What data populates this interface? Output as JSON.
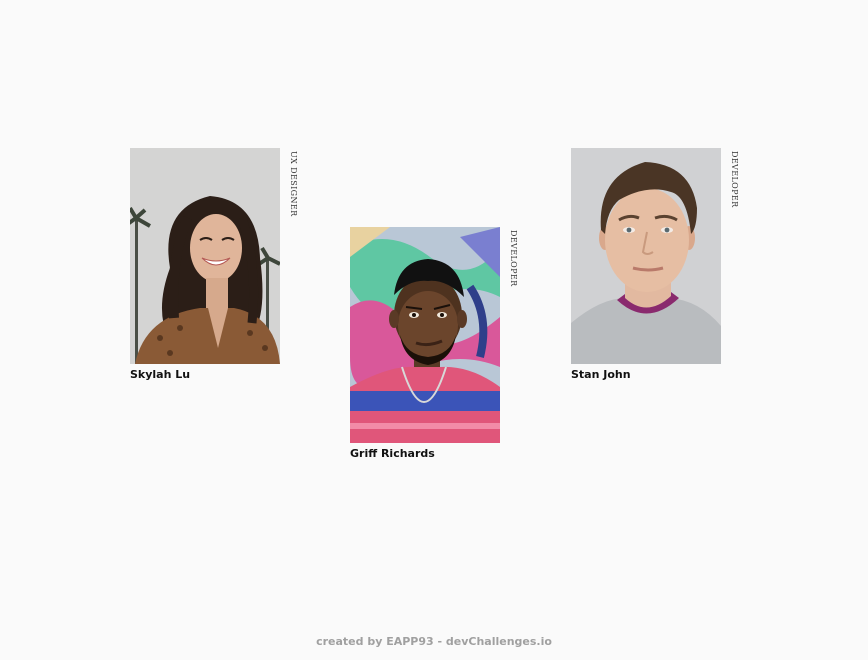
{
  "team": [
    {
      "name": "Skylah Lu",
      "role": "UX DESIGNER"
    },
    {
      "name": "Griff Richards",
      "role": "DEVELOPER"
    },
    {
      "name": "Stan John",
      "role": "DEVELOPER"
    }
  ],
  "footer": {
    "text": "created by EAPP93 - devChallenges.io"
  }
}
